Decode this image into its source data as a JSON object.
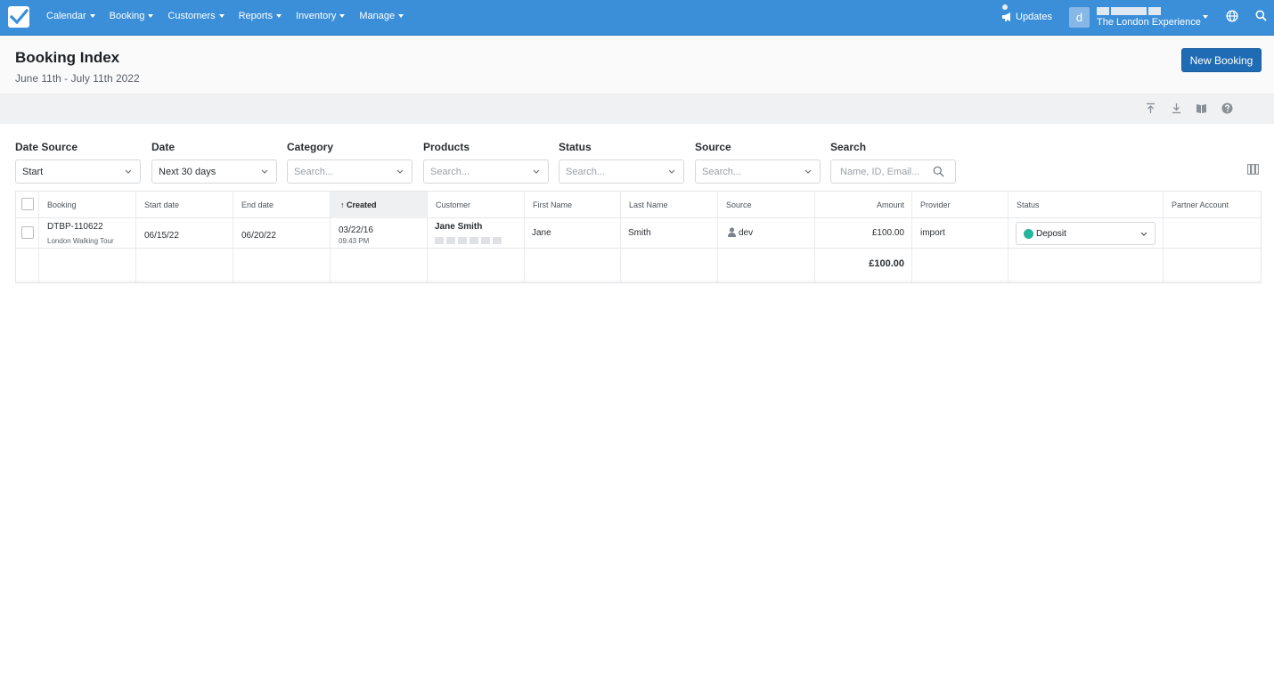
{
  "nav": {
    "items": [
      {
        "label": "Calendar"
      },
      {
        "label": "Booking"
      },
      {
        "label": "Customers"
      },
      {
        "label": "Reports"
      },
      {
        "label": "Inventory"
      },
      {
        "label": "Manage"
      }
    ],
    "updates_label": "Updates",
    "avatar_letter": "d",
    "account_name": "The London Experience"
  },
  "header": {
    "title": "Booking Index",
    "subtitle": "June 11th - July 11th 2022",
    "new_booking_label": "New Booking"
  },
  "filters": {
    "date_source": {
      "label": "Date Source",
      "value": "Start"
    },
    "date": {
      "label": "Date",
      "value": "Next 30 days"
    },
    "category": {
      "label": "Category",
      "placeholder": "Search..."
    },
    "products": {
      "label": "Products",
      "placeholder": "Search..."
    },
    "status": {
      "label": "Status",
      "placeholder": "Search..."
    },
    "source": {
      "label": "Source",
      "placeholder": "Search..."
    },
    "search": {
      "label": "Search",
      "placeholder": "Name, ID, Email..."
    }
  },
  "table": {
    "columns": {
      "booking": "Booking",
      "start_date": "Start date",
      "end_date": "End date",
      "created": "Created",
      "customer": "Customer",
      "first_name": "First Name",
      "last_name": "Last Name",
      "source": "Source",
      "amount": "Amount",
      "provider": "Provider",
      "status": "Status",
      "partner_account": "Partner Account"
    },
    "rows": [
      {
        "booking_id": "DTBP-110622",
        "product": "London Walking Tour",
        "start_date": "06/15/22",
        "end_date": "06/20/22",
        "created_date": "03/22/16",
        "created_time": "09:43 PM",
        "customer": "Jane Smith",
        "first_name": "Jane",
        "last_name": "Smith",
        "source": "dev",
        "amount": "£100.00",
        "provider": "import",
        "status": "Deposit",
        "status_color": "#24b59a"
      }
    ],
    "total_amount": "£100.00"
  },
  "icons": {
    "logo": "checkmark-logo-icon",
    "updates": "megaphone-icon",
    "globe": "globe-icon",
    "search": "search-icon",
    "export": "upload-icon",
    "download": "download-icon",
    "guide": "book-icon",
    "help": "help-icon",
    "columns": "columns-icon"
  },
  "colors": {
    "nav_bg": "#3b8fd9",
    "primary_button": "#1f6cb5",
    "status_deposit": "#24b59a"
  }
}
